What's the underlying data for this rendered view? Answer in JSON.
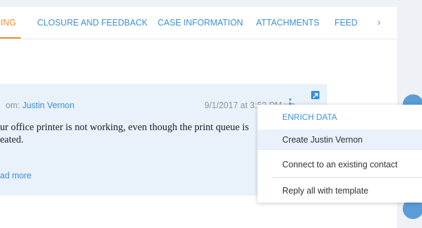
{
  "tabs": [
    {
      "label": "ING",
      "active": true
    },
    {
      "label": "CLOSURE AND FEEDBACK",
      "active": false
    },
    {
      "label": "CASE INFORMATION",
      "active": false
    },
    {
      "label": "ATTACHMENTS",
      "active": false
    },
    {
      "label": "FEED",
      "active": false
    }
  ],
  "tab_arrow_icon": "chevron-right-icon",
  "email": {
    "from_prefix": "om: ",
    "from_name": "Justin Vernon",
    "meta": "9/1/2017 at 3:53 PM via",
    "body_line1": "ur office printer is not working, even though the print queue is",
    "body_line2": "eated.",
    "read_more": "ad more"
  },
  "menu": {
    "header": "ENRICH DATA",
    "items": [
      "Create Justin Vernon",
      "Connect to an existing contact",
      "Reply all with template"
    ]
  },
  "colors": {
    "accent": "#3a8fd6",
    "active_tab": "#f08c2c",
    "card_bg": "#e9f1fb"
  }
}
